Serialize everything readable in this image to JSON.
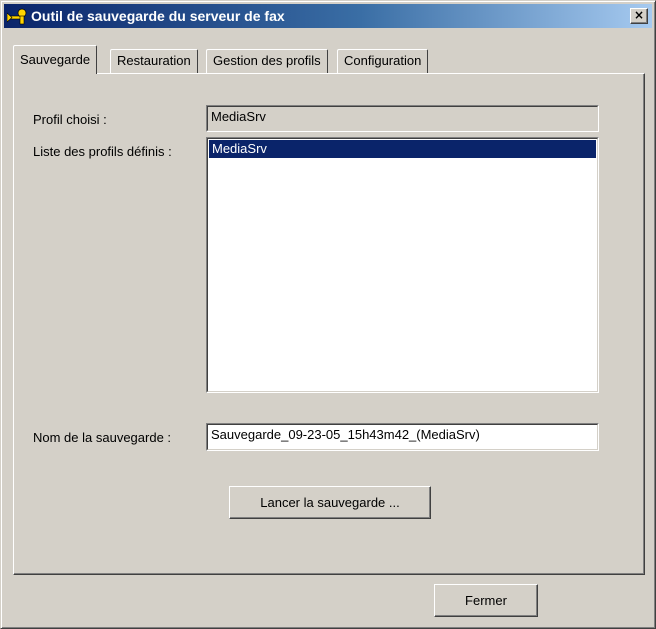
{
  "window": {
    "title": "Outil de sauvegarde du serveur de fax",
    "close_glyph": "×",
    "icon": "fax-backup-icon"
  },
  "tabs": [
    {
      "label": "Sauvegarde",
      "active": true
    },
    {
      "label": "Restauration",
      "active": false
    },
    {
      "label": "Gestion des profils",
      "active": false
    },
    {
      "label": "Configuration",
      "active": false
    }
  ],
  "backup": {
    "chosen_profile_label": "Profil choisi :",
    "chosen_profile_value": "MediaSrv",
    "profiles_list_label": "Liste des profils définis :",
    "profiles": [
      "MediaSrv"
    ],
    "selected_profile": "MediaSrv",
    "backup_name_label": "Nom de la sauvegarde :",
    "backup_name_value": "Sauvegarde_09-23-05_15h43m42_(MediaSrv)",
    "start_button": "Lancer la sauvegarde ..."
  },
  "footer": {
    "close_button": "Fermer"
  },
  "colors": {
    "titlebar_start": "#0a246a",
    "titlebar_end": "#a6caf0",
    "selection": "#0a246a",
    "face": "#d4d0c8"
  }
}
